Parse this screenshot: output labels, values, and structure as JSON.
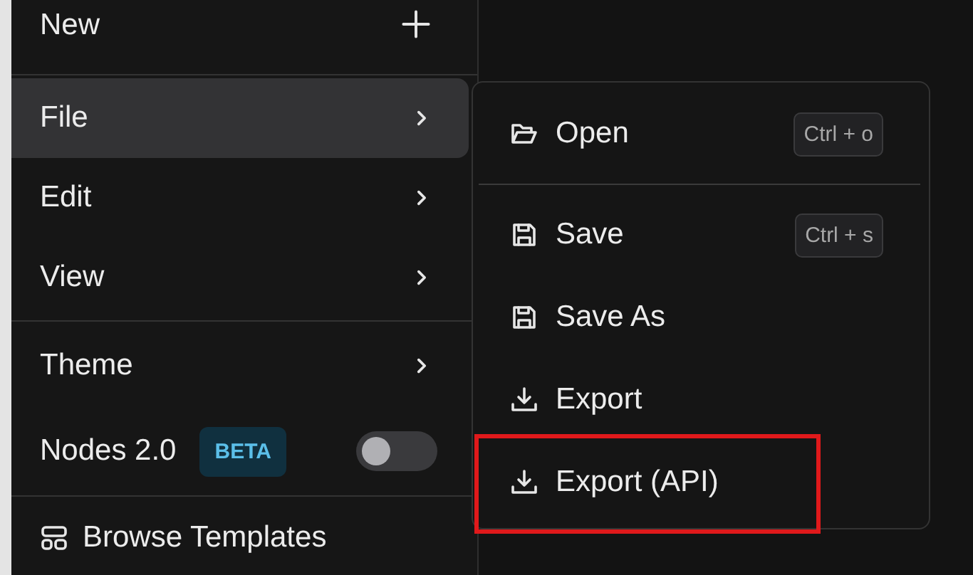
{
  "menu": {
    "groups": [
      [
        {
          "kind": "action",
          "label": "New",
          "selected": false
        }
      ],
      [
        {
          "kind": "submenu",
          "label": "File",
          "selected": true
        },
        {
          "kind": "submenu",
          "label": "Edit",
          "selected": false
        },
        {
          "kind": "submenu",
          "label": "View",
          "selected": false
        }
      ],
      [
        {
          "kind": "submenu",
          "label": "Theme",
          "selected": false
        },
        {
          "kind": "toggle",
          "label": "Nodes 2.0",
          "badge": "BETA",
          "on": false,
          "selected": false
        }
      ],
      [
        {
          "kind": "link",
          "label": "Browse Templates",
          "selected": false
        }
      ]
    ]
  },
  "submenu": {
    "groups": [
      [
        {
          "kind": "open",
          "label": "Open",
          "shortcut": "Ctrl + o",
          "highlighted": false
        }
      ],
      [
        {
          "kind": "save",
          "label": "Save",
          "shortcut": "Ctrl + s",
          "highlighted": false
        },
        {
          "kind": "save",
          "label": "Save As",
          "highlighted": false
        },
        {
          "kind": "export",
          "label": "Export",
          "highlighted": false
        },
        {
          "kind": "export",
          "label": "Export (API)",
          "highlighted": true
        }
      ]
    ]
  }
}
